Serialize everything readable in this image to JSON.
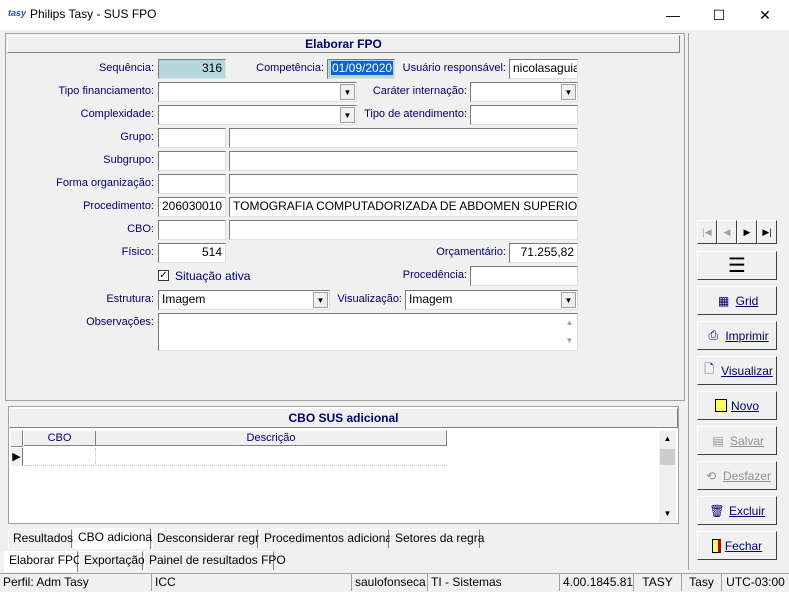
{
  "window": {
    "title": "Philips Tasy - SUS FPO",
    "app_icon_text": "tasy",
    "minimize": "—",
    "maximize": "☐",
    "close": "✕"
  },
  "form": {
    "section_title": "Elaborar FPO",
    "sequencia_label": "Sequência:",
    "sequencia_value": "316",
    "competencia_label": "Competência:",
    "competencia_value": "01/09/2020",
    "usuario_label": "Usuário responsável:",
    "usuario_value": "nicolasaguiar",
    "tipo_financiamento_label": "Tipo financiamento:",
    "tipo_financiamento_value": "",
    "carater_label": "Caráter internação:",
    "carater_value": "",
    "complexidade_label": "Complexidade:",
    "complexidade_value": "",
    "tipo_atendimento_label": "Tipo de atendimento:",
    "tipo_atendimento_value": "",
    "grupo_label": "Grupo:",
    "grupo_code": "",
    "grupo_desc": "",
    "subgrupo_label": "Subgrupo:",
    "subgrupo_code": "",
    "subgrupo_desc": "",
    "forma_label": "Forma organização:",
    "forma_code": "",
    "forma_desc": "",
    "procedimento_label": "Procedimento:",
    "procedimento_code": "206030010",
    "procedimento_desc": "TOMOGRAFIA COMPUTADORIZADA DE ABDOMEN SUPERIOR",
    "cbo_label": "CBO:",
    "cbo_code": "",
    "cbo_desc": "",
    "fisico_label": "Físico:",
    "fisico_value": "514",
    "orcamentario_label": "Orçamentário:",
    "orcamentario_value": "71.255,82",
    "situacao_label": "Situação ativa",
    "situacao_checked": true,
    "procedencia_label": "Procedência:",
    "procedencia_value": "",
    "estrutura_label": "Estrutura:",
    "estrutura_value": "Imagem",
    "visualizacao_label": "Visualização:",
    "visualizacao_value": "Imagem",
    "observacoes_label": "Observações:",
    "observacoes_value": ""
  },
  "cbo_panel": {
    "title": "CBO SUS adicional",
    "columns": [
      "CBO",
      "Descrição"
    ],
    "row_marker": "▶"
  },
  "subtabs": [
    "Resultados",
    "CBO adicional",
    "Desconsiderar regra",
    "Procedimentos adicionais",
    "Setores da regra"
  ],
  "maintabs": [
    "Elaborar FPO",
    "Exportação",
    "Painel de resultados FPO"
  ],
  "toolbar": {
    "nav_first": "|◀",
    "nav_prev": "◀",
    "nav_next": "▶",
    "nav_last": "▶|",
    "menu": "☰",
    "grid": "Grid",
    "imprimir": "Imprimir",
    "visualizar": "Visualizar",
    "novo": "Novo",
    "salvar": "Salvar",
    "desfazer": "Desfazer",
    "excluir": "Excluir",
    "fechar": "Fechar"
  },
  "statusbar": {
    "perfil": "Perfil: Adm Tasy",
    "estab": "ICC",
    "user": "saulofonseca",
    "setor": "TI - Sistemas",
    "version": "4.00.1845.81",
    "db": "TASY",
    "app": "Tasy",
    "tz": "UTC-03:00"
  }
}
